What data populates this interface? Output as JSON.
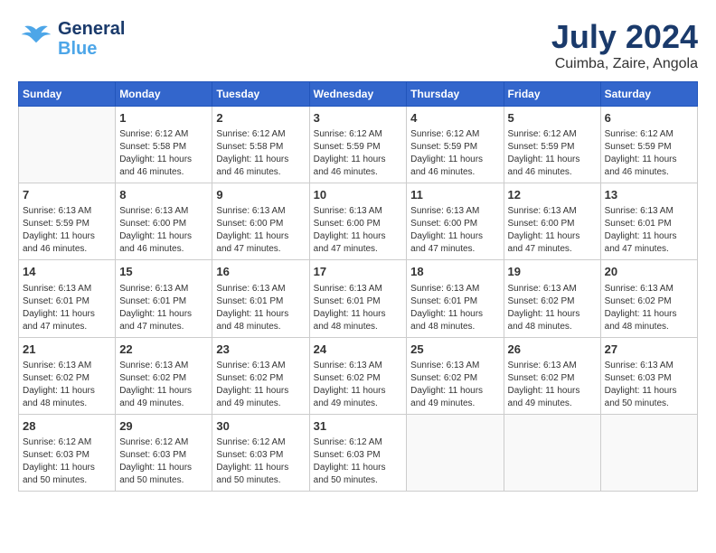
{
  "header": {
    "logo_line1": "General",
    "logo_line2": "Blue",
    "month": "July 2024",
    "location": "Cuimba, Zaire, Angola"
  },
  "days_of_week": [
    "Sunday",
    "Monday",
    "Tuesday",
    "Wednesday",
    "Thursday",
    "Friday",
    "Saturday"
  ],
  "weeks": [
    [
      {
        "day": "",
        "info": ""
      },
      {
        "day": "1",
        "info": "Sunrise: 6:12 AM\nSunset: 5:58 PM\nDaylight: 11 hours and 46 minutes."
      },
      {
        "day": "2",
        "info": "Sunrise: 6:12 AM\nSunset: 5:58 PM\nDaylight: 11 hours and 46 minutes."
      },
      {
        "day": "3",
        "info": "Sunrise: 6:12 AM\nSunset: 5:59 PM\nDaylight: 11 hours and 46 minutes."
      },
      {
        "day": "4",
        "info": "Sunrise: 6:12 AM\nSunset: 5:59 PM\nDaylight: 11 hours and 46 minutes."
      },
      {
        "day": "5",
        "info": "Sunrise: 6:12 AM\nSunset: 5:59 PM\nDaylight: 11 hours and 46 minutes."
      },
      {
        "day": "6",
        "info": "Sunrise: 6:12 AM\nSunset: 5:59 PM\nDaylight: 11 hours and 46 minutes."
      }
    ],
    [
      {
        "day": "7",
        "info": "Sunrise: 6:13 AM\nSunset: 5:59 PM\nDaylight: 11 hours and 46 minutes."
      },
      {
        "day": "8",
        "info": "Sunrise: 6:13 AM\nSunset: 6:00 PM\nDaylight: 11 hours and 46 minutes."
      },
      {
        "day": "9",
        "info": "Sunrise: 6:13 AM\nSunset: 6:00 PM\nDaylight: 11 hours and 47 minutes."
      },
      {
        "day": "10",
        "info": "Sunrise: 6:13 AM\nSunset: 6:00 PM\nDaylight: 11 hours and 47 minutes."
      },
      {
        "day": "11",
        "info": "Sunrise: 6:13 AM\nSunset: 6:00 PM\nDaylight: 11 hours and 47 minutes."
      },
      {
        "day": "12",
        "info": "Sunrise: 6:13 AM\nSunset: 6:00 PM\nDaylight: 11 hours and 47 minutes."
      },
      {
        "day": "13",
        "info": "Sunrise: 6:13 AM\nSunset: 6:01 PM\nDaylight: 11 hours and 47 minutes."
      }
    ],
    [
      {
        "day": "14",
        "info": "Sunrise: 6:13 AM\nSunset: 6:01 PM\nDaylight: 11 hours and 47 minutes."
      },
      {
        "day": "15",
        "info": "Sunrise: 6:13 AM\nSunset: 6:01 PM\nDaylight: 11 hours and 47 minutes."
      },
      {
        "day": "16",
        "info": "Sunrise: 6:13 AM\nSunset: 6:01 PM\nDaylight: 11 hours and 48 minutes."
      },
      {
        "day": "17",
        "info": "Sunrise: 6:13 AM\nSunset: 6:01 PM\nDaylight: 11 hours and 48 minutes."
      },
      {
        "day": "18",
        "info": "Sunrise: 6:13 AM\nSunset: 6:01 PM\nDaylight: 11 hours and 48 minutes."
      },
      {
        "day": "19",
        "info": "Sunrise: 6:13 AM\nSunset: 6:02 PM\nDaylight: 11 hours and 48 minutes."
      },
      {
        "day": "20",
        "info": "Sunrise: 6:13 AM\nSunset: 6:02 PM\nDaylight: 11 hours and 48 minutes."
      }
    ],
    [
      {
        "day": "21",
        "info": "Sunrise: 6:13 AM\nSunset: 6:02 PM\nDaylight: 11 hours and 48 minutes."
      },
      {
        "day": "22",
        "info": "Sunrise: 6:13 AM\nSunset: 6:02 PM\nDaylight: 11 hours and 49 minutes."
      },
      {
        "day": "23",
        "info": "Sunrise: 6:13 AM\nSunset: 6:02 PM\nDaylight: 11 hours and 49 minutes."
      },
      {
        "day": "24",
        "info": "Sunrise: 6:13 AM\nSunset: 6:02 PM\nDaylight: 11 hours and 49 minutes."
      },
      {
        "day": "25",
        "info": "Sunrise: 6:13 AM\nSunset: 6:02 PM\nDaylight: 11 hours and 49 minutes."
      },
      {
        "day": "26",
        "info": "Sunrise: 6:13 AM\nSunset: 6:02 PM\nDaylight: 11 hours and 49 minutes."
      },
      {
        "day": "27",
        "info": "Sunrise: 6:13 AM\nSunset: 6:03 PM\nDaylight: 11 hours and 50 minutes."
      }
    ],
    [
      {
        "day": "28",
        "info": "Sunrise: 6:12 AM\nSunset: 6:03 PM\nDaylight: 11 hours and 50 minutes."
      },
      {
        "day": "29",
        "info": "Sunrise: 6:12 AM\nSunset: 6:03 PM\nDaylight: 11 hours and 50 minutes."
      },
      {
        "day": "30",
        "info": "Sunrise: 6:12 AM\nSunset: 6:03 PM\nDaylight: 11 hours and 50 minutes."
      },
      {
        "day": "31",
        "info": "Sunrise: 6:12 AM\nSunset: 6:03 PM\nDaylight: 11 hours and 50 minutes."
      },
      {
        "day": "",
        "info": ""
      },
      {
        "day": "",
        "info": ""
      },
      {
        "day": "",
        "info": ""
      }
    ]
  ]
}
